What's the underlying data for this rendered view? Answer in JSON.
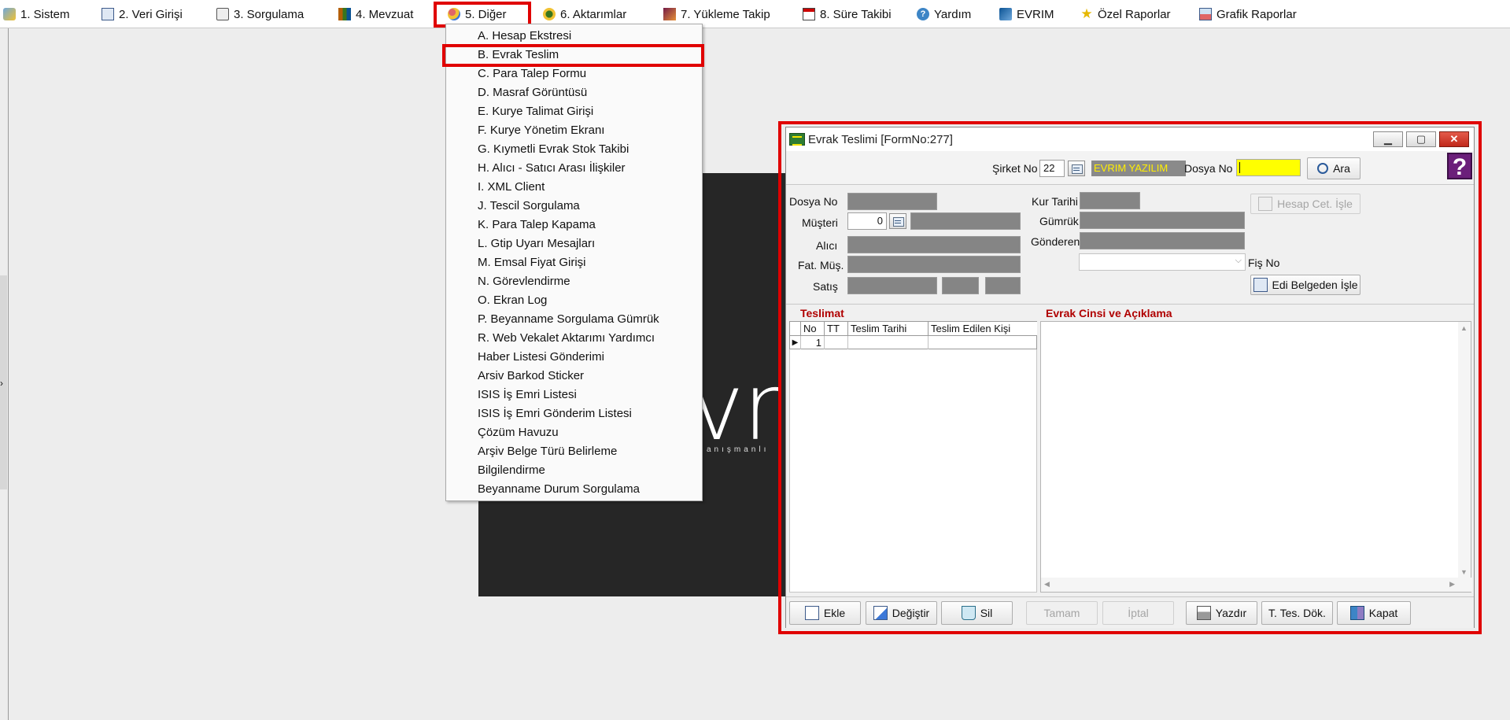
{
  "menubar": {
    "items": [
      {
        "label": "1.  Sistem",
        "icon": "system-icon"
      },
      {
        "label": "2.  Veri Girişi",
        "icon": "data-entry-icon"
      },
      {
        "label": "3.  Sorgulama",
        "icon": "query-icon"
      },
      {
        "label": "4.  Mevzuat",
        "icon": "books-icon"
      },
      {
        "label": "5.  Diğer",
        "icon": "other-icon"
      },
      {
        "label": "6.  Aktarımlar",
        "icon": "transfer-icon"
      },
      {
        "label": "7.  Yükleme Takip",
        "icon": "upload-track-icon"
      },
      {
        "label": "8. Süre Takibi",
        "icon": "calendar-icon"
      },
      {
        "label": "Yardım",
        "icon": "help-icon"
      },
      {
        "label": "EVRIM",
        "icon": "evrim-icon"
      },
      {
        "label": "Özel Raporlar",
        "icon": "star-icon"
      },
      {
        "label": "Grafik Raporlar",
        "icon": "chart-report-icon"
      }
    ],
    "highlight_color": "#e00000"
  },
  "background_logo": {
    "text": "vri",
    "subtext": "anışmanlı"
  },
  "dropdown": {
    "items": [
      "A. Hesap Ekstresi",
      "B. Evrak Teslim",
      "C. Para Talep Formu",
      "D. Masraf Görüntüsü",
      "E. Kurye Talimat Girişi",
      "F. Kurye Yönetim Ekranı",
      "G. Kıymetli Evrak Stok Takibi",
      "H. Alıcı - Satıcı Arası İlişkiler",
      "I. XML Client",
      "J. Tescil Sorgulama",
      "K. Para Talep Kapama",
      "L. Gtip Uyarı Mesajları",
      "M. Emsal Fiyat Girişi",
      "N. Görevlendirme",
      "O. Ekran Log",
      "P. Beyanname Sorgulama Gümrük",
      "R. Web Vekalet Aktarımı Yardımcı",
      "Haber Listesi Gönderimi",
      "Arsiv Barkod Sticker",
      "ISIS İş Emri Listesi",
      "ISIS İş Emri Gönderim Listesi",
      "Çözüm Havuzu",
      "Arşiv Belge Türü Belirleme",
      "Bilgilendirme",
      "Beyanname Durum Sorgulama"
    ]
  },
  "window": {
    "title": "Evrak Teslimi [FormNo:277]",
    "search": {
      "sirket_label": "Şirket No",
      "sirket_value": "22",
      "company_name": "EVRIM YAZILIM",
      "dosya_label": "Dosya No",
      "dosya_value": "",
      "search_button": "Ara"
    },
    "form": {
      "dosya_no": "Dosya No",
      "musteri": "Müşteri",
      "musteri_value": "0",
      "alici": "Alıcı",
      "fat_mus": "Fat. Müş.",
      "satis": "Satış",
      "kur_tarihi": "Kur Tarihi",
      "gumruk": "Gümrük",
      "gonderen": "Gönderen",
      "fis_no": "Fiş No",
      "hesap_btn": "Hesap Cet. İşle",
      "edi_btn": "Edi Belgeden İşle"
    },
    "teslimat": {
      "header": "Teslimat",
      "columns": [
        "No",
        "TT",
        "Teslim Tarihi",
        "Teslim Edilen Kişi"
      ],
      "rows": [
        [
          "1",
          "",
          "",
          ""
        ]
      ]
    },
    "evrak_header": "Evrak Cinsi ve Açıklama",
    "buttons": {
      "ekle": "Ekle",
      "degistir": "Değiştir",
      "sil": "Sil",
      "tamam": "Tamam",
      "iptal": "İptal",
      "yazdir": "Yazdır",
      "tes_dok": "T. Tes. Dök.",
      "kapat": "Kapat"
    },
    "help_glyph": "?"
  }
}
